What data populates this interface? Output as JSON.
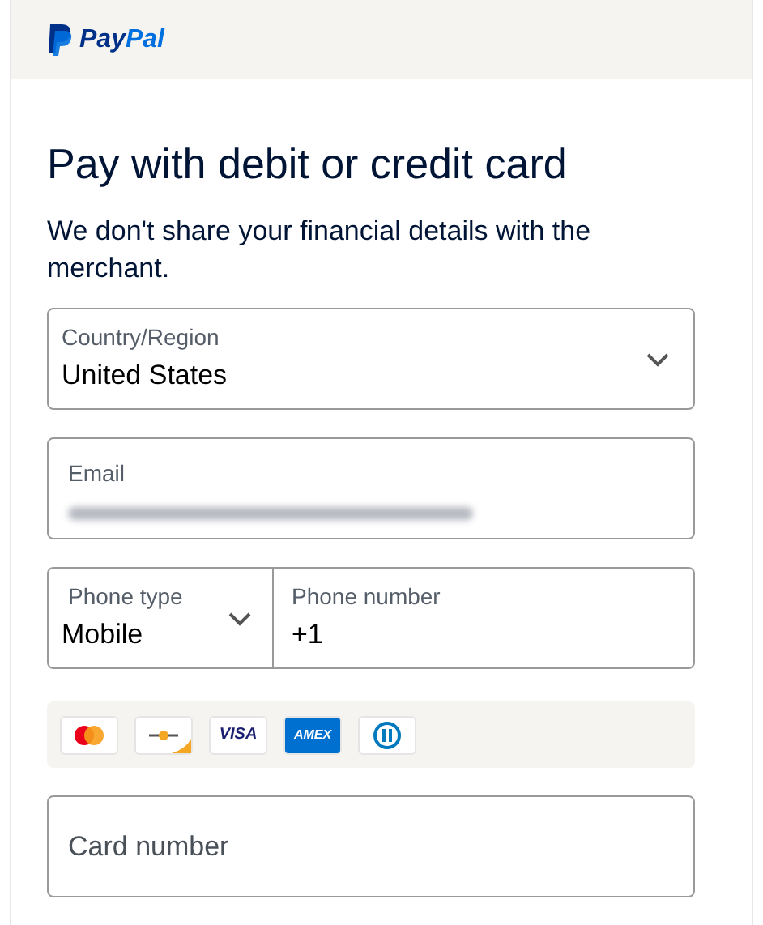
{
  "header": {
    "logo": {
      "part_1": "Pay",
      "part_2": "Pal"
    }
  },
  "title": "Pay with debit or credit card",
  "subtitle": "We don't share your financial details with the merchant.",
  "country": {
    "label": "Country/Region",
    "value": "United States"
  },
  "email": {
    "label": "Email",
    "redacted": true
  },
  "phone_type": {
    "label": "Phone type",
    "value": "Mobile"
  },
  "phone_number": {
    "label": "Phone number",
    "value": "+1"
  },
  "card_brands": [
    {
      "kind": "mastercard"
    },
    {
      "kind": "discover"
    },
    {
      "kind": "visa",
      "label": "VISA"
    },
    {
      "kind": "amex",
      "label": "AMEX"
    },
    {
      "kind": "diners"
    }
  ],
  "card_number": {
    "placeholder": "Card number"
  }
}
